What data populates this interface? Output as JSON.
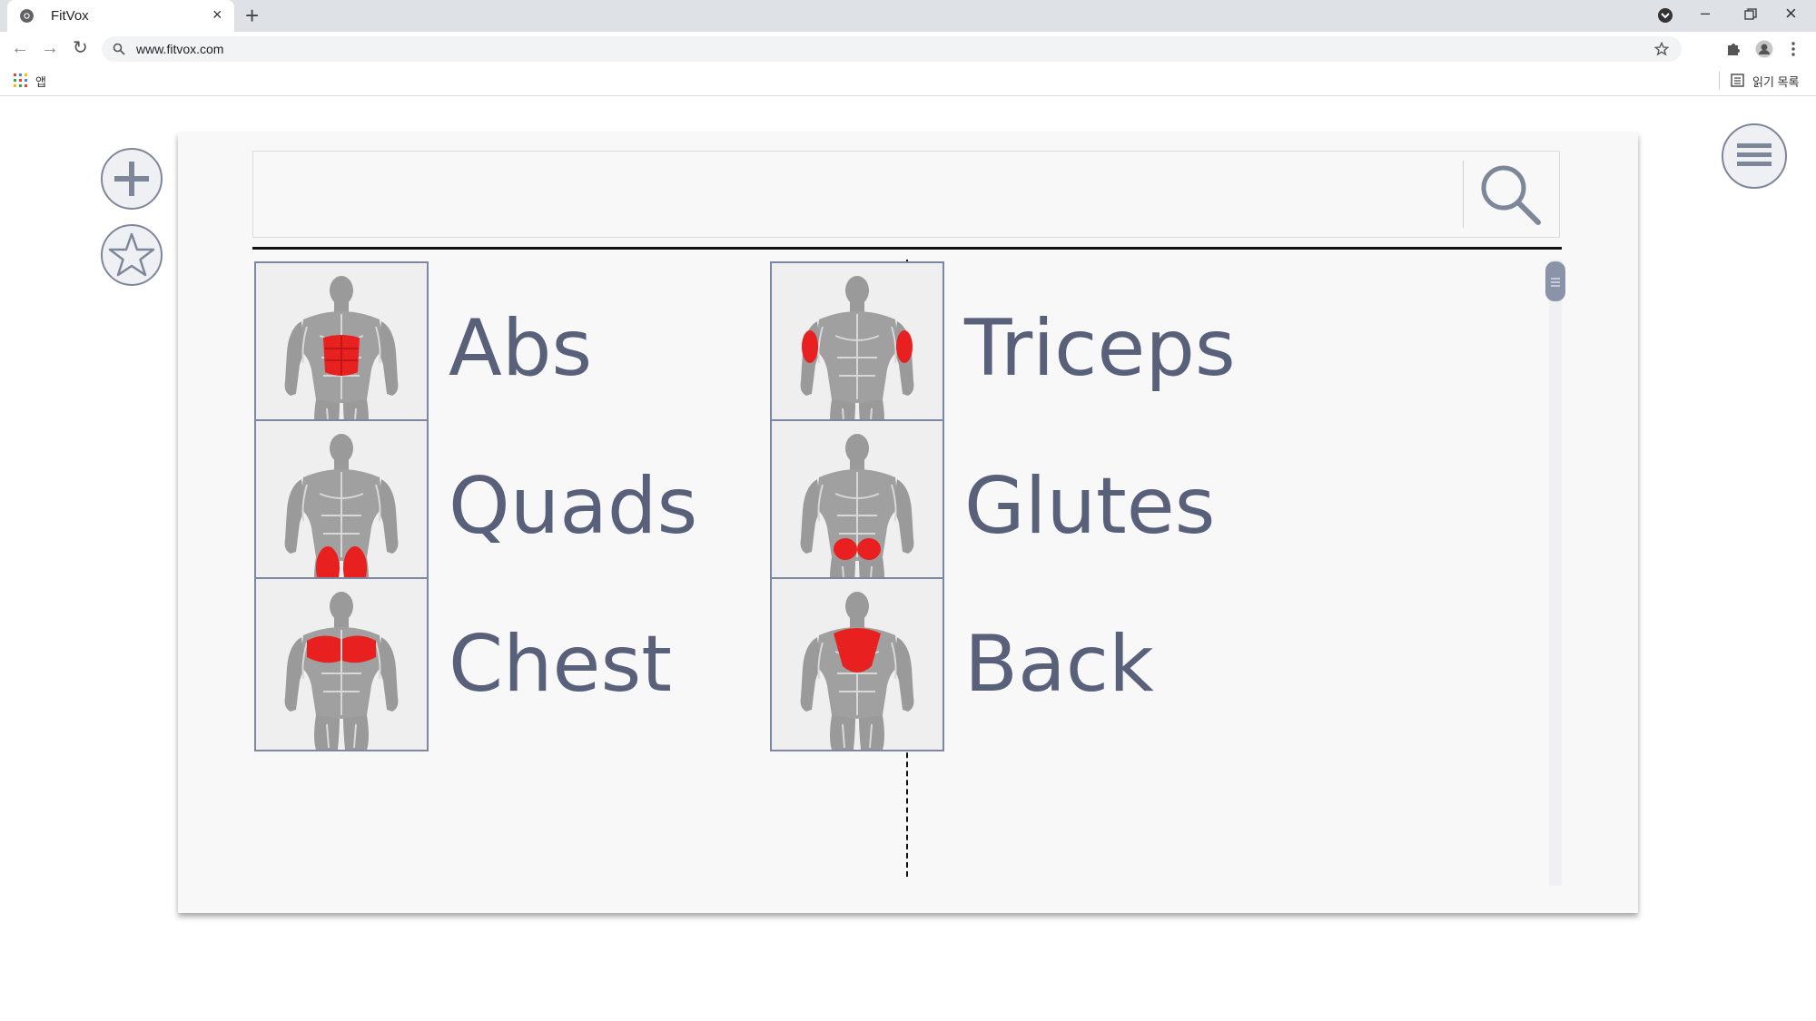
{
  "browser": {
    "tab_title": "FitVox",
    "new_tab_symbol": "+",
    "url": "www.fitvox.com",
    "bookmarks_apps_label": "앱",
    "reading_list_label": "읽기 목록"
  },
  "app": {
    "search_placeholder": "",
    "muscle_groups": [
      {
        "label": "Abs",
        "highlight": "abs",
        "view": "front"
      },
      {
        "label": "Triceps",
        "highlight": "triceps",
        "view": "back"
      },
      {
        "label": "Quads",
        "highlight": "quads",
        "view": "front"
      },
      {
        "label": "Glutes",
        "highlight": "glutes",
        "view": "back"
      },
      {
        "label": "Chest",
        "highlight": "chest",
        "view": "front"
      },
      {
        "label": "Back",
        "highlight": "upper-back",
        "view": "back"
      }
    ]
  },
  "icons": [
    "plus-icon",
    "star-icon",
    "hamburger-menu-icon",
    "search-icon"
  ],
  "colors": {
    "accent": "#7e8799",
    "label_text": "#59607a",
    "muscle_highlight": "#e8201f",
    "panel_bg": "#f8f8f8"
  }
}
